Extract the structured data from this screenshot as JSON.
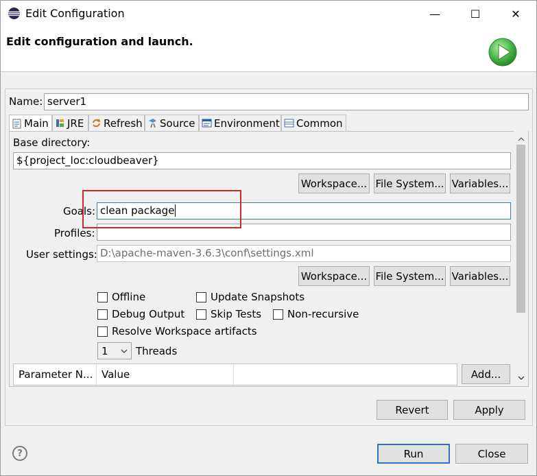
{
  "window": {
    "title": "Edit Configuration",
    "minimize_glyph": "—",
    "maximize_glyph": "☐",
    "close_glyph": "✕"
  },
  "header": {
    "title": "Edit configuration and launch."
  },
  "name": {
    "label": "Name:",
    "value": "server1"
  },
  "tabs": [
    {
      "label": "Main",
      "icon": "document-icon"
    },
    {
      "label": "JRE",
      "icon": "jre-icon"
    },
    {
      "label": "Refresh",
      "icon": "refresh-icon"
    },
    {
      "label": "Source",
      "icon": "source-icon"
    },
    {
      "label": "Environment",
      "icon": "environment-icon"
    },
    {
      "label": "Common",
      "icon": "common-icon"
    }
  ],
  "main": {
    "base_directory_label": "Base directory:",
    "base_directory_value": "${project_loc:cloudbeaver}",
    "workspace_button": "Workspace...",
    "file_system_button": "File System...",
    "variables_button": "Variables...",
    "goals_label": "Goals:",
    "goals_value": "clean package",
    "profiles_label": "Profiles:",
    "profiles_value": "",
    "user_settings_label": "User settings:",
    "user_settings_value": "D:\\apache-maven-3.6.3\\conf\\settings.xml",
    "checkboxes": {
      "offline": "Offline",
      "update_snapshots": "Update Snapshots",
      "debug_output": "Debug Output",
      "skip_tests": "Skip Tests",
      "non_recursive": "Non-recursive",
      "resolve_workspace": "Resolve Workspace artifacts"
    },
    "threads_value": "1",
    "threads_label": "Threads",
    "table": {
      "columns": [
        "Parameter N...",
        "Value"
      ]
    },
    "add_button": "Add..."
  },
  "footer": {
    "revert_button": "Revert",
    "apply_button": "Apply",
    "run_button": "Run",
    "close_button": "Close",
    "help_glyph": "?"
  },
  "colors": {
    "highlight": "#d9242a",
    "accent": "#2b73c9",
    "run_green": "#3aa53a"
  }
}
